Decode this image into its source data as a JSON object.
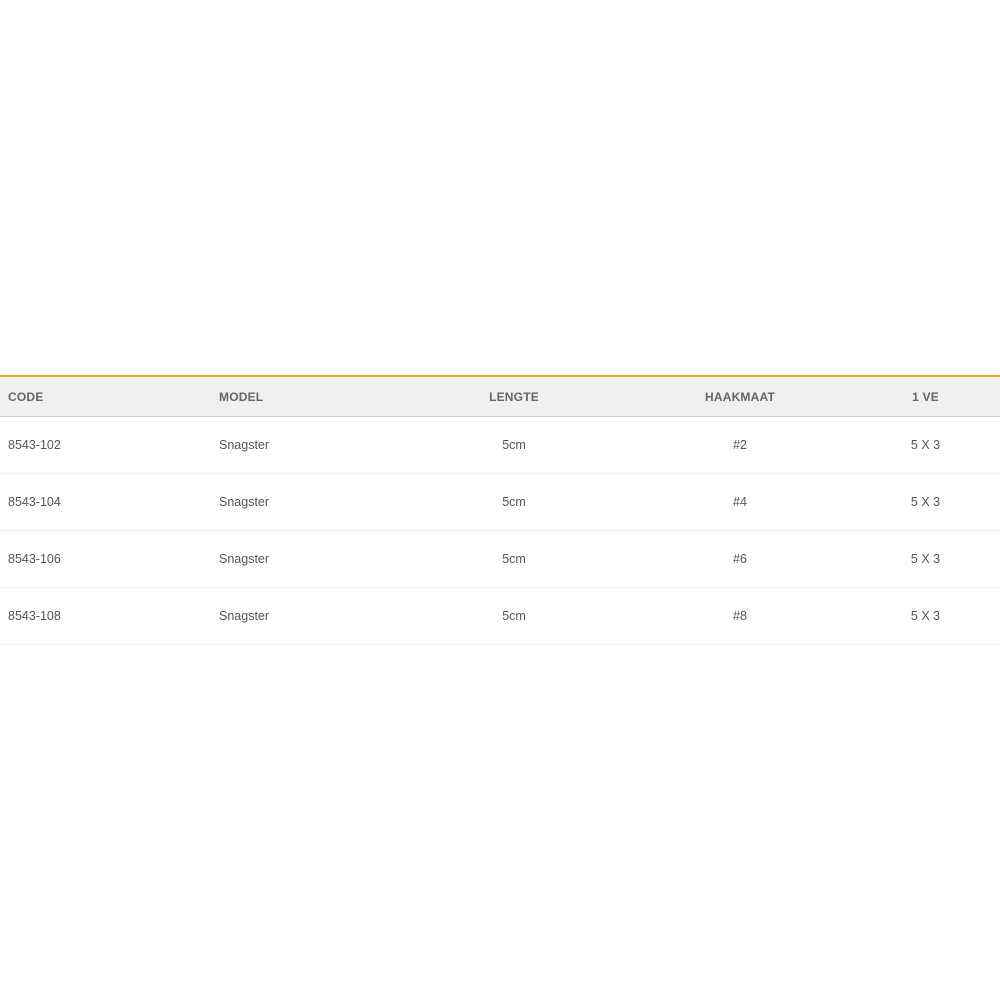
{
  "table": {
    "headers": [
      "CODE",
      "MODEL",
      "LENGTE",
      "HAAKMAAT",
      "1 VE"
    ],
    "rows": [
      [
        "8543-102",
        "Snagster",
        "5cm",
        "#2",
        "5 X 3"
      ],
      [
        "8543-104",
        "Snagster",
        "5cm",
        "#4",
        "5 X 3"
      ],
      [
        "8543-106",
        "Snagster",
        "5cm",
        "#6",
        "5 X 3"
      ],
      [
        "8543-108",
        "Snagster",
        "5cm",
        "#8",
        "5 X 3"
      ]
    ]
  },
  "colors": {
    "accent": "#e8a72c",
    "header_bg": "#f0f0f0",
    "text": "#555555"
  }
}
